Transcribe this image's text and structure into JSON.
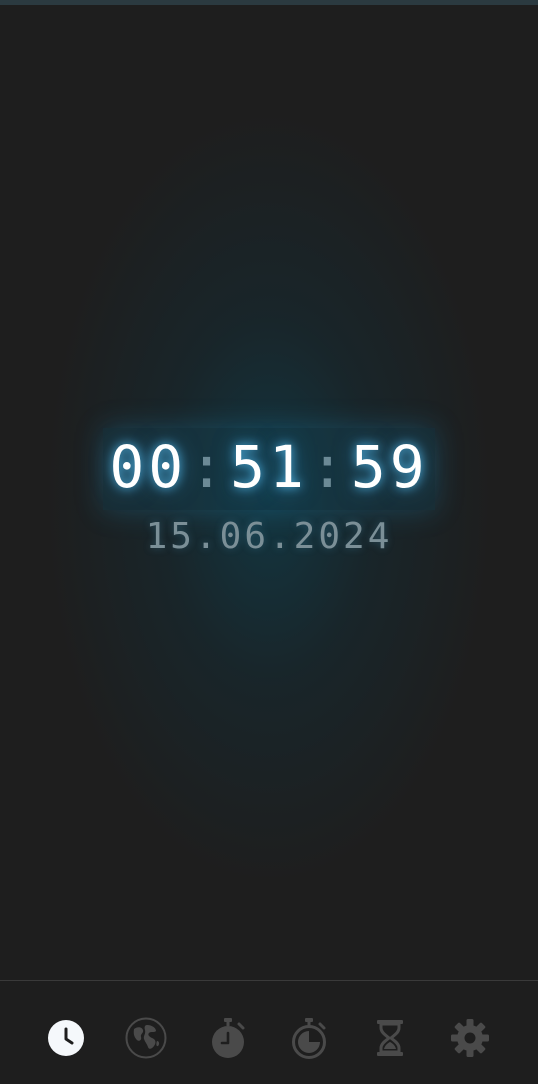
{
  "clock": {
    "hours": "00",
    "minutes": "51",
    "seconds": "59",
    "separator": ":",
    "date": "15.06.2024"
  },
  "nav": {
    "active_tab": "clock",
    "items": [
      {
        "id": "clock",
        "icon": "clock-icon",
        "active": true
      },
      {
        "id": "world-clock",
        "icon": "globe-icon",
        "active": false
      },
      {
        "id": "stopwatch",
        "icon": "stopwatch-icon",
        "active": false
      },
      {
        "id": "timer",
        "icon": "timer-icon",
        "active": false
      },
      {
        "id": "hourglass",
        "icon": "hourglass-icon",
        "active": false
      },
      {
        "id": "settings",
        "icon": "gear-icon",
        "active": false
      }
    ]
  },
  "colors": {
    "background": "#1e1e1e",
    "glow": "#0e4050",
    "time_text": "#ffffff",
    "date_text": "#7b8f97",
    "icon_active": "#ffffff",
    "icon_inactive": "#4a4a4a"
  }
}
